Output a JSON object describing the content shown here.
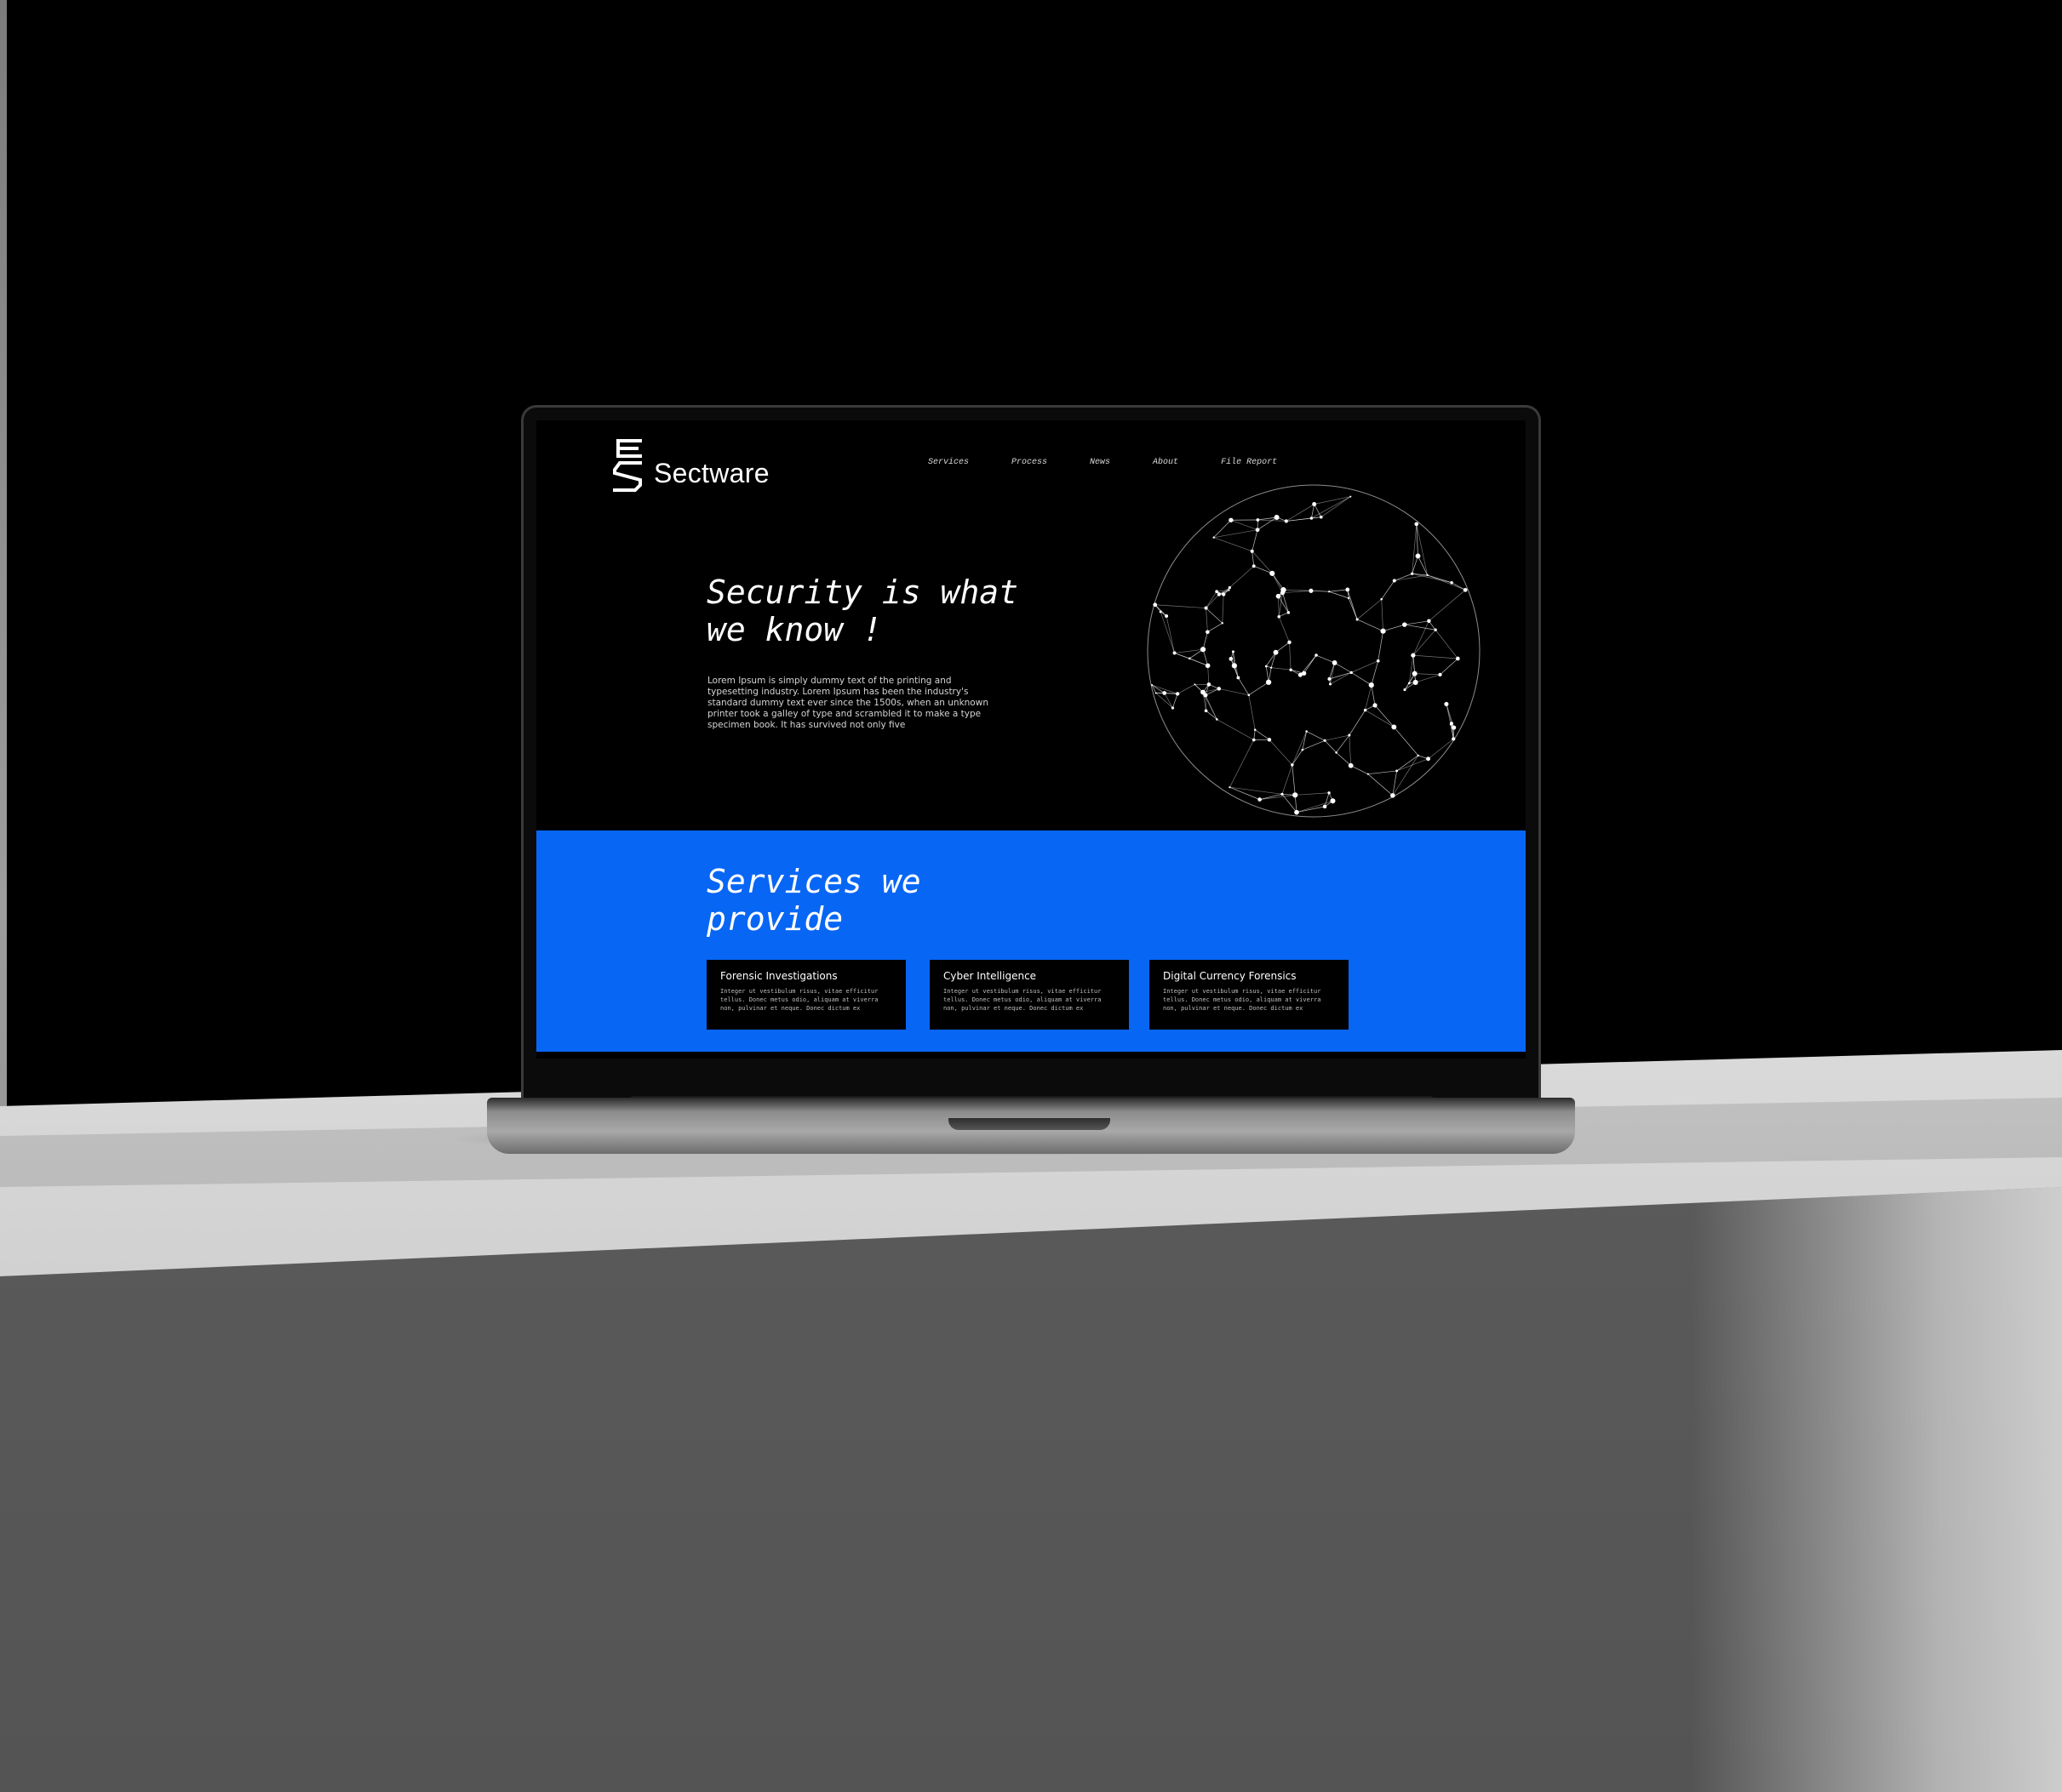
{
  "brand": {
    "name": "Sectware",
    "logo_icon": "sectware-s-logo"
  },
  "nav": {
    "items": [
      {
        "label": "Services"
      },
      {
        "label": "Process"
      },
      {
        "label": "News"
      },
      {
        "label": "About"
      },
      {
        "label": "File Report"
      }
    ]
  },
  "hero": {
    "title": "Security is what we know !",
    "body": "Lorem Ipsum is simply dummy text of the printing and typesetting industry. Lorem Ipsum has been the industry's standard dummy text ever since the 1500s, when an unknown printer took a galley of type and scrambled it to make a type specimen book. It has survived not only five",
    "globe_icon": "network-globe-icon"
  },
  "services": {
    "title": "Services we provide",
    "cards": [
      {
        "title": "Forensic Investigations",
        "body": "Integer ut vestibulum risus, vitae efficitur tellus. Donec metus odio, aliquam at viverra non, pulvinar et neque. Donec dictum ex"
      },
      {
        "title": "Cyber Intelligence",
        "body": "Integer ut vestibulum risus, vitae efficitur tellus. Donec metus odio, aliquam at viverra non, pulvinar et neque. Donec dictum ex"
      },
      {
        "title": "Digital Currency Forensics",
        "body": "Integer ut vestibulum risus, vitae efficitur tellus. Donec metus odio, aliquam at viverra non, pulvinar et neque. Donec dictum ex"
      }
    ]
  },
  "colors": {
    "accent_blue": "#0866f5",
    "background": "#000000",
    "text": "#ffffff"
  }
}
